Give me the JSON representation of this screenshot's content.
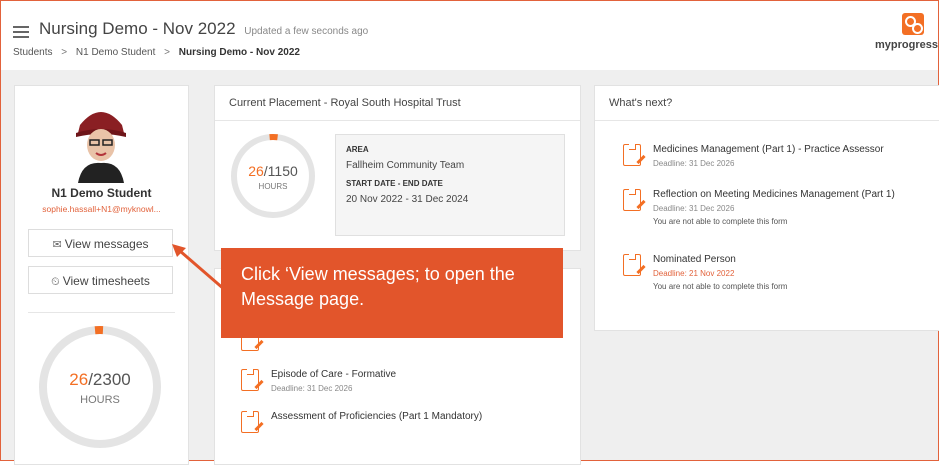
{
  "header": {
    "title": "Nursing Demo - Nov 2022",
    "updated": "Updated a few seconds ago",
    "breadcrumbs": [
      "Students",
      "N1 Demo Student",
      "Nursing Demo - Nov 2022"
    ],
    "logo_text": "myprogress",
    "brand_color": "#f36f24"
  },
  "profile": {
    "name": "N1 Demo Student",
    "email": "sophie.hassall+N1@myknowl...",
    "view_messages": "View messages",
    "view_timesheets": "View timesheets",
    "hours_done": "26",
    "hours_total": "/2300",
    "hours_unit": "HOURS",
    "hours_fraction": 0.011
  },
  "placement": {
    "heading": "Current Placement - Royal South Hospital Trust",
    "hours_done": "26",
    "hours_total": "/1150",
    "hours_unit": "HOURS",
    "hours_fraction": 0.023,
    "area_label": "AREA",
    "area_value": "Fallheim Community Team",
    "dates_label": "START DATE - END DATE",
    "dates_value": "20 Nov 2022 - 31 Dec 2024"
  },
  "tasks": [
    {
      "title": "Episode of Care - Formative",
      "deadline": "Deadline: 31 Dec 2026"
    },
    {
      "title": "Assessment of Proficiencies (Part 1 Mandatory)"
    }
  ],
  "whats_next": {
    "heading": "What's next?",
    "items": [
      {
        "title": "Medicines Management (Part 1) - Practice Assessor",
        "deadline": "Deadline: 31 Dec 2026"
      },
      {
        "title": "Reflection on Meeting Medicines Management (Part 1)",
        "deadline": "Deadline: 31 Dec 2026",
        "note": "You are not able to complete this form"
      },
      {
        "title": "Nominated Person",
        "deadline": "Deadline: 21 Nov 2022",
        "note": "You are not able to complete this form"
      }
    ]
  },
  "callout": {
    "text": "Click ‘View messages; to open the Message page.",
    "color": "#e2552b"
  }
}
